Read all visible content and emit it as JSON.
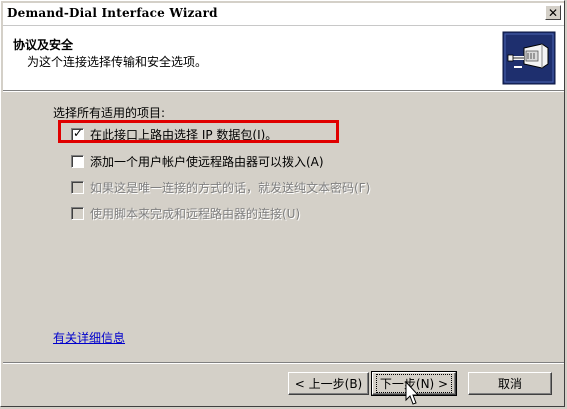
{
  "window": {
    "title": "Demand-Dial Interface Wizard",
    "close_glyph": "✕"
  },
  "header": {
    "title": "协议及安全",
    "subtitle": "为这个连接选择传输和安全选项。",
    "icon": "network-cable-icon"
  },
  "options": {
    "group_label": "选择所有适用的项目:",
    "items": [
      {
        "label": "在此接口上路由选择 IP 数据包(I)。",
        "checked": true,
        "enabled": true
      },
      {
        "label": "添加一个用户帐户使远程路由器可以拨入(A)",
        "checked": false,
        "enabled": true
      },
      {
        "label": "如果这是唯一连接的方式的话，就发送纯文本密码(F)",
        "checked": false,
        "enabled": false
      },
      {
        "label": "使用脚本来完成和远程路由器的连接(U)",
        "checked": false,
        "enabled": false
      }
    ]
  },
  "link": {
    "label": "有关详细信息"
  },
  "buttons": {
    "back": "< 上一步(B)",
    "next": "下一步(N) >",
    "cancel": "取消"
  },
  "colors": {
    "highlight": "#E00000",
    "link": "#0000CC",
    "dialog_bg": "#D4D0C8"
  }
}
